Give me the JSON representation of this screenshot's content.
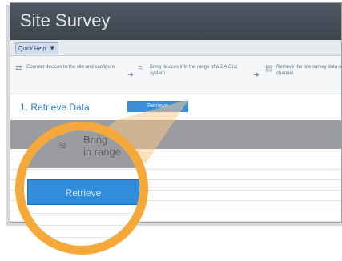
{
  "window": {
    "title": "Site Survey"
  },
  "menubar": {
    "quick_label": "Quick Help"
  },
  "steps": [
    {
      "text": "Connect devices to the site and configure",
      "icon": "plug-icon"
    },
    {
      "text": "Bring devices into the range of a 2.4 GHz system",
      "icon": "signal-icon"
    },
    {
      "text": "Retrieve the site survey data and select a channel",
      "icon": "graph-icon"
    }
  ],
  "retrieve_row": {
    "link_label": "1. Retrieve Data",
    "small_button_label": "Retrieve"
  },
  "magnifier": {
    "header_text_line1": "Bring",
    "header_text_line2": "in range",
    "button_label": "Retrieve"
  },
  "colors": {
    "accent": "#2f8ddc",
    "magnifier_ring": "#f5a93a",
    "titlebar": "#434b55"
  }
}
